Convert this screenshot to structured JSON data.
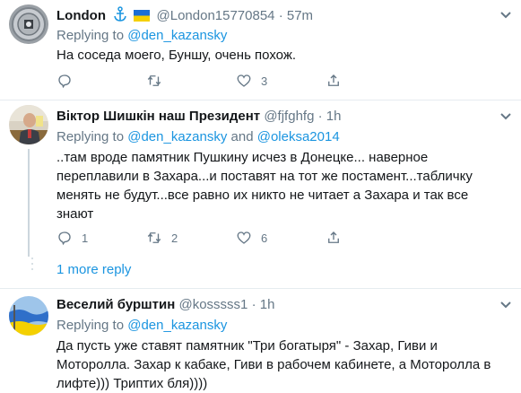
{
  "tweets": [
    {
      "name": "London",
      "handle": "@London15770854",
      "separator": "·",
      "time": "57m",
      "reply_prefix": "Replying to",
      "reply_to": "@den_kazansky",
      "text": "На соседа моего, Буншу, очень похож.",
      "replies": "",
      "retweets": "",
      "likes": "3",
      "badge_icons": [
        "anchor-icon",
        "ukraine-flag-icon"
      ]
    },
    {
      "name": "Віктор Шишкін наш Президент",
      "handle": "@fjfghfg",
      "separator": "·",
      "time": "1h",
      "reply_prefix": "Replying to",
      "reply_to": "@den_kazansky",
      "reply_and": "and",
      "reply_to_2": "@oleksa2014",
      "text_lines": [
        "..там вроде памятник Пушкину исчез в Донецке... наверное",
        "переплавили в Захара...и поставят на тот же постамент...табличку",
        "менять не будут...все равно их никто не читает а Захара и так все",
        "знают"
      ],
      "replies": "1",
      "retweets": "2",
      "likes": "6"
    },
    {
      "name": "Веселий бурштин",
      "handle": "@kosssss1",
      "separator": "·",
      "time": "1h",
      "reply_prefix": "Replying to",
      "reply_to": "@den_kazansky",
      "text_lines": [
        "Да пусть уже ставят памятник \"Три богатыря\" - Захар, Гиви и",
        "Моторолла. Захар к кабаке, Гиви в рабочем  кабинете, а Моторолла в",
        "лифте))) Триптих бля))))"
      ]
    }
  ],
  "more_replies_label": "1 more reply",
  "colors": {
    "link": "#1b95e0",
    "muted": "#657786",
    "divider": "#e6ecf0",
    "text": "#14171a"
  },
  "icons": {
    "reply": "reply-icon",
    "retweet": "retweet-icon",
    "like": "heart-icon",
    "share": "share-icon",
    "caret": "chevron-down-icon"
  }
}
